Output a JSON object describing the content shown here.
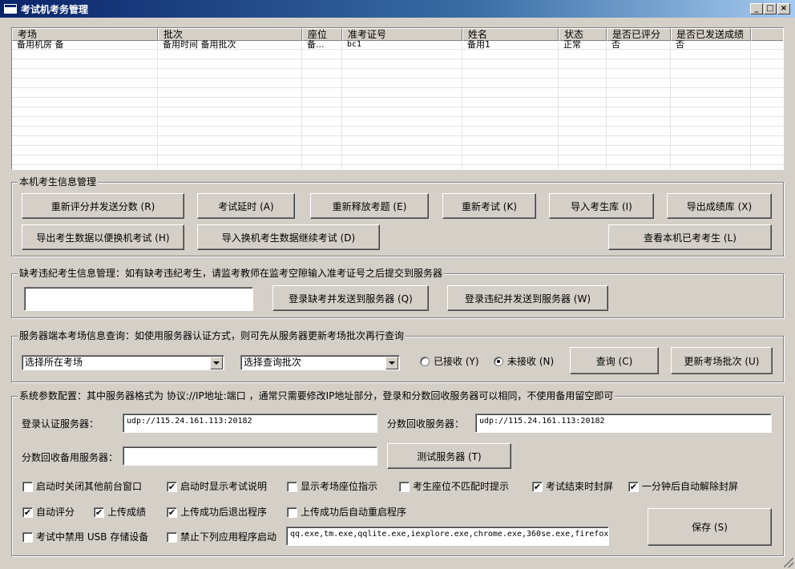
{
  "window": {
    "title": "考试机考务管理",
    "minimize": "_",
    "maximize": "□",
    "close": "×"
  },
  "table": {
    "columns": [
      "考场",
      "批次",
      "座位",
      "准考证号",
      "姓名",
      "状态",
      "是否已评分",
      "是否已发送成绩"
    ],
    "rows": [
      [
        "备用机房 备",
        "备用时间 备用批次",
        "备...",
        "bc1",
        "备用1",
        "正常",
        "否",
        "否"
      ]
    ]
  },
  "local_mgmt": {
    "label": "本机考生信息管理",
    "btn_rescore": "重新评分并发送分数 (R)",
    "btn_extend": "考试延时 (A)",
    "btn_release": "重新释放考题 (E)",
    "btn_retest": "重新考试 (K)",
    "btn_import_db": "导入考生库 (I)",
    "btn_export_scores": "导出成绩库 (X)",
    "btn_export_switch": "导出考生数据以便换机考试 (H)",
    "btn_import_switch": "导入换机考生数据继续考试 (D)",
    "btn_view_done": "查看本机已考考生 (L)"
  },
  "absent": {
    "label": "缺考违纪考生信息管理：如有缺考违纪考生，请监考教师在监考空隙输入准考证号之后提交到服务器",
    "input_value": "",
    "btn_absent": "登录缺考并发送到服务器 (Q)",
    "btn_violation": "登录违纪并发送到服务器 (W)"
  },
  "server_query": {
    "label": "服务器端本考场信息查询：如使用服务器认证方式，则可先从服务器更新考场批次再行查询",
    "room_select": "选择所在考场",
    "batch_select": "选择查询批次",
    "radio_received": "已接收 (Y)",
    "radio_not_received": "未接收 (N)",
    "btn_query": "查询 (C)",
    "btn_update": "更新考场批次 (U)"
  },
  "sys_config": {
    "label": "系统参数配置：其中服务器格式为 协议://IP地址:端口 ，通常只需要修改IP地址部分，登录和分数回收服务器可以相同，不使用备用留空即可",
    "login_server_label": "登录认证服务器：",
    "login_server_value": "udp://115.24.161.113:20182",
    "score_server_label": "分数回收服务器：",
    "score_server_value": "udp://115.24.161.113:20182",
    "backup_server_label": "分数回收备用服务器：",
    "backup_server_value": "",
    "btn_test": "测试服务器 (T)",
    "checkboxes": {
      "close_bg": {
        "label": "启动时关闭其他前台窗口",
        "checked": false
      },
      "show_desc": {
        "label": "启动时显示考试说明",
        "checked": true
      },
      "show_seat": {
        "label": "显示考场座位指示",
        "checked": false
      },
      "seat_mismatch": {
        "label": "考生座位不匹配时提示",
        "checked": false
      },
      "lock_end": {
        "label": "考试结束时封屏",
        "checked": true
      },
      "auto_unlock": {
        "label": "一分钟后自动解除封屏",
        "checked": true
      },
      "auto_score": {
        "label": "自动评分",
        "checked": true
      },
      "upload": {
        "label": "上传成绩",
        "checked": true
      },
      "exit_after": {
        "label": "上传成功后退出程序",
        "checked": true
      },
      "restart_after": {
        "label": "上传成功后自动重启程序",
        "checked": false
      },
      "ban_usb": {
        "label": "考试中禁用 USB 存储设备",
        "checked": false
      },
      "ban_apps": {
        "label": "禁止下列应用程序启动",
        "checked": false
      }
    },
    "banned_apps": "qq.exe,tm.exe,qqlite.exe,iexplore.exe,chrome.exe,360se.exe,firefox.",
    "btn_save": "保存 (S)",
    "check_mark": "✔"
  }
}
